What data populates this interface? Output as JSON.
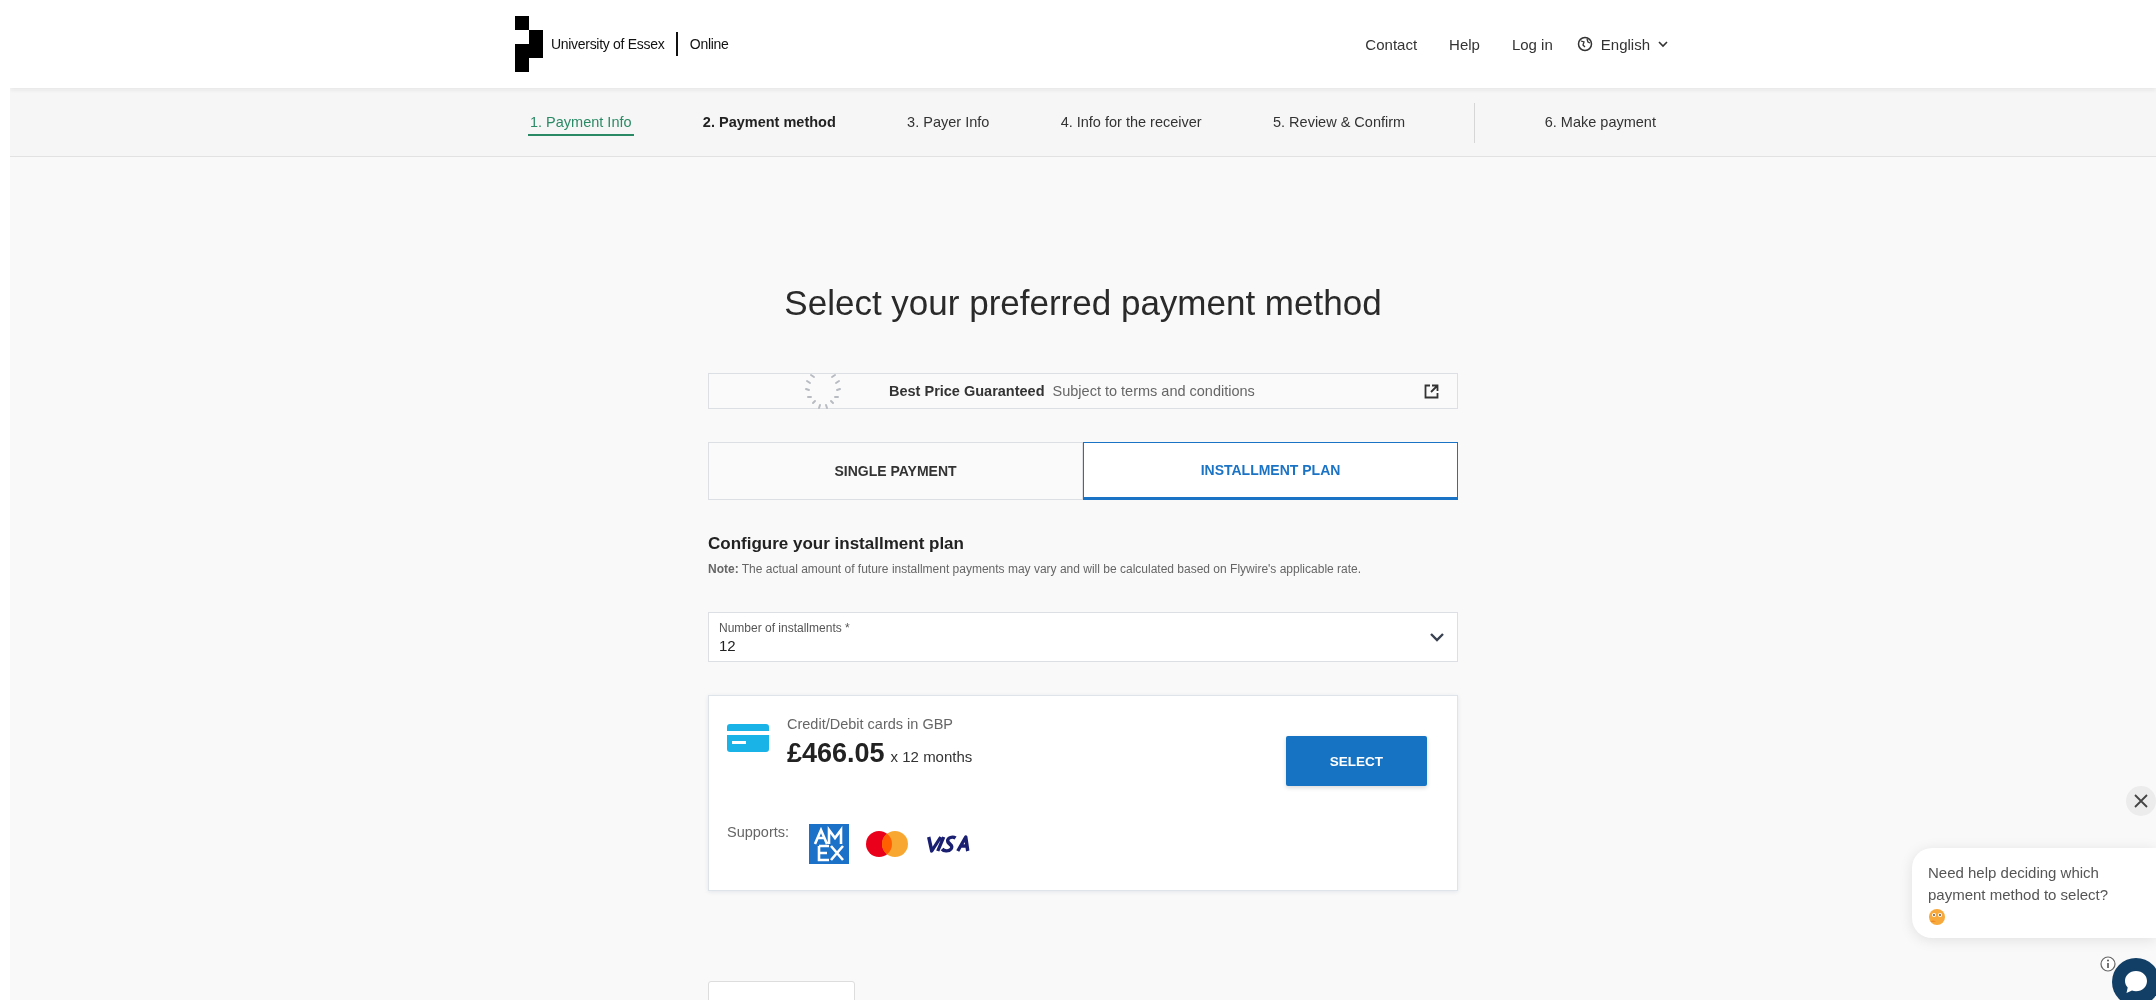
{
  "header": {
    "logo_text": "University of Essex",
    "logo_suffix": "Online",
    "nav": [
      "Contact",
      "Help",
      "Log in"
    ],
    "language": "English"
  },
  "steps": [
    {
      "label": "1. Payment Info",
      "kind": "done"
    },
    {
      "label": "2. Payment method",
      "kind": "current"
    },
    {
      "label": "3. Payer Info",
      "kind": "upcoming"
    },
    {
      "label": "4. Info for the receiver",
      "kind": "upcoming"
    },
    {
      "label": "5. Review & Confirm",
      "kind": "upcoming"
    },
    {
      "label": "6. Make payment",
      "kind": "upcoming"
    }
  ],
  "title": "Select your preferred payment method",
  "guarantee": {
    "title": "Best Price Guaranteed",
    "subtitle": "Subject to terms and conditions"
  },
  "tabs": [
    {
      "label": "SINGLE PAYMENT",
      "selected": false
    },
    {
      "label": "INSTALLMENT PLAN",
      "selected": true
    }
  ],
  "plan": {
    "heading": "Configure your installment plan",
    "note": "**Note:** The actual amount of future installment payments may vary and will be calculated based on Flywire's applicable rate.",
    "installments": {
      "label": "Number of installments *",
      "value": "12"
    }
  },
  "option": {
    "name": "Credit/Debit cards in GBP",
    "amount": "£466.05",
    "period": "x 12 months",
    "button": "SELECT",
    "supports_label": "Supports:"
  },
  "chat": {
    "message": "Need help deciding which payment method to select?"
  }
}
